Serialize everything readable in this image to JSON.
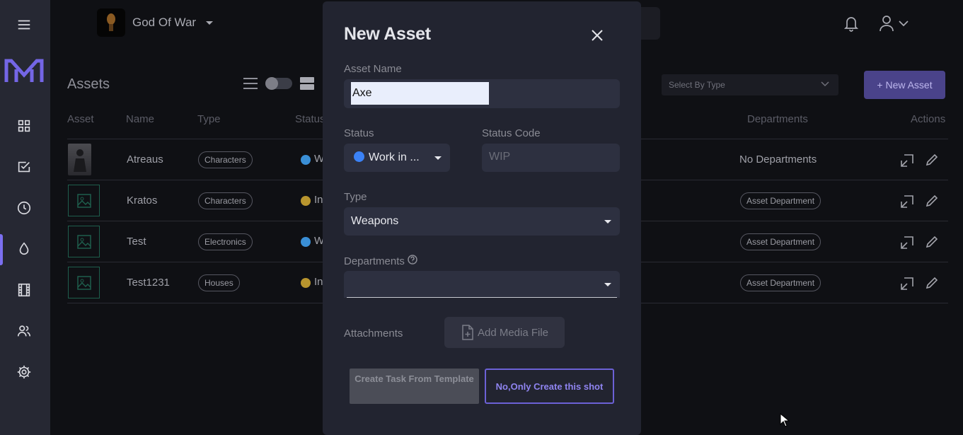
{
  "project": {
    "name": "God Of War"
  },
  "page": {
    "title": "Assets"
  },
  "filters": {
    "type_placeholder": "Select By Type",
    "new_asset_label": "+ New Asset"
  },
  "table": {
    "headers": {
      "asset": "Asset",
      "name": "Name",
      "type": "Type",
      "status": "Status",
      "departments": "Departments",
      "actions": "Actions"
    },
    "rows": [
      {
        "name": "Atreaus",
        "type": "Characters",
        "status_fragment": "W",
        "status_color": "#3a8fd6",
        "departments": "No Departments"
      },
      {
        "name": "Kratos",
        "type": "Characters",
        "status_fragment": "In",
        "status_color": "#b8952e",
        "departments": "Asset Department"
      },
      {
        "name": "Test",
        "type": "Electronics",
        "status_fragment": "W",
        "status_color": "#3a8fd6",
        "departments": "Asset Department"
      },
      {
        "name": "Test1231",
        "type": "Houses",
        "status_fragment": "In",
        "status_color": "#b8952e",
        "departments": "Asset Department"
      }
    ]
  },
  "modal": {
    "title": "New Asset",
    "asset_name_label": "Asset Name",
    "asset_name_value": "Axe",
    "status_label": "Status",
    "status_value": "Work in ...",
    "status_code_label": "Status Code",
    "status_code_placeholder": "WIP",
    "type_label": "Type",
    "type_value": "Weapons",
    "departments_label": "Departments",
    "attachments_label": "Attachments",
    "add_media_label": "Add Media File",
    "create_template_label": "Create Task From Template",
    "only_create_label": "No,Only Create this shot"
  },
  "colors": {
    "accent": "#6c61d6",
    "sidebar_bg": "#262833",
    "modal_bg": "#222430"
  }
}
